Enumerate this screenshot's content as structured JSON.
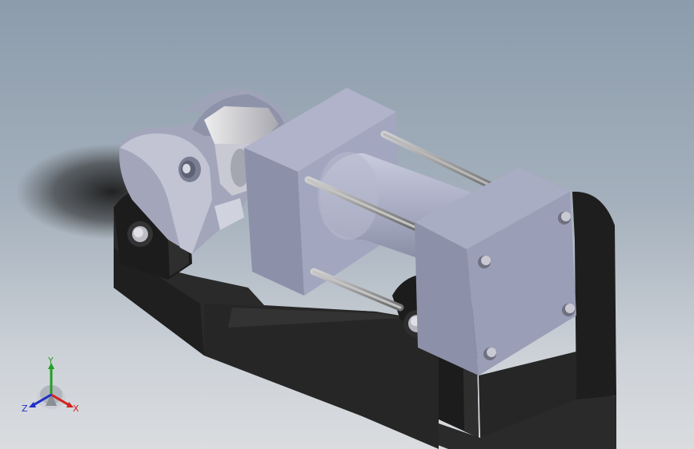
{
  "viewport": {
    "background_top": "#8c9cac",
    "background_bottom": "#dadcdf"
  },
  "model": {
    "part_colors": {
      "base": "#2b2b2b",
      "cylinder_block": "#9a9fb8",
      "cylinder_face": "#7f84a0",
      "rod": "#8f8f8f",
      "clevis": "#b7bacb"
    }
  },
  "triad": {
    "x_label": "X",
    "y_label": "Y",
    "z_label": "Z",
    "x_color": "#d42020",
    "y_color": "#22a022",
    "z_color": "#2030c8"
  }
}
